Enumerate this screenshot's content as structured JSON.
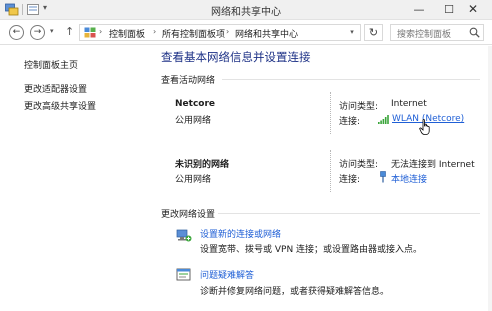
{
  "window": {
    "title": "网络和共享中心",
    "controls": {
      "minimize": "—",
      "maximize": "☐",
      "close": "✕"
    }
  },
  "address": {
    "breadcrumbs": [
      "控制面板",
      "所有控制面板项",
      "网络和共享中心"
    ],
    "search_placeholder": "搜索控制面板"
  },
  "sidebar": {
    "items": [
      {
        "label": "控制面板主页"
      },
      {
        "label": "更改适配器设置"
      },
      {
        "label": "更改高级共享设置"
      }
    ]
  },
  "main": {
    "title": "查看基本网络信息并设置连接",
    "active_networks_heading": "查看活动网络",
    "networks": [
      {
        "name": "Netcore",
        "type": "公用网络",
        "access_type_label": "访问类型:",
        "access_type": "Internet",
        "connection_label": "连接:",
        "connection": "WLAN (Netcore)",
        "connection_icon": "wifi-signal-icon"
      },
      {
        "name": "未识别的网络",
        "type": "公用网络",
        "access_type_label": "访问类型:",
        "access_type": "无法连接到 Internet",
        "connection_label": "连接:",
        "connection": "本地连接",
        "connection_icon": "ethernet-icon"
      }
    ],
    "change_settings_heading": "更改网络设置",
    "tasks": [
      {
        "link": "设置新的连接或网络",
        "description": "设置宽带、拨号或 VPN 连接；或设置路由器或接入点。",
        "icon": "new-connection-icon"
      },
      {
        "link": "问题疑难解答",
        "description": "诊断并修复网络问题，或者获得疑难解答信息。",
        "icon": "troubleshoot-icon"
      }
    ]
  },
  "colors": {
    "link": "#1f5fd6",
    "title": "#1e3287",
    "wifi_green": "#3aa53a"
  }
}
